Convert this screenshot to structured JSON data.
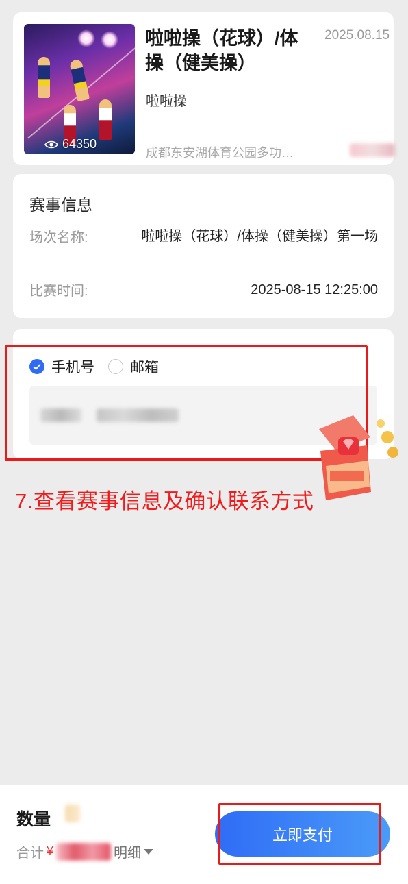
{
  "event": {
    "title": "啦啦操（花球）/体操（健美操）",
    "date": "2025.08.15",
    "category": "啦啦操",
    "venue": "成都东安湖体育公园多功…",
    "views": "64350"
  },
  "match_info": {
    "section_title": "赛事信息",
    "session_label": "场次名称:",
    "session_value": "啦啦操（花球）/体操（健美操）第一场",
    "time_label": "比赛时间:",
    "time_value": "2025-08-15 12:25:00"
  },
  "contact": {
    "options": [
      {
        "label": "手机号",
        "selected": true
      },
      {
        "label": "邮箱",
        "selected": false
      }
    ]
  },
  "annotation": "7.查看赛事信息及确认联系方式",
  "footer": {
    "quantity_label": "数量",
    "total_label": "合计",
    "currency_symbol": "¥",
    "detail_label": "明细",
    "pay_button": "立即支付"
  },
  "colors": {
    "accent": "#2f6cf6",
    "highlight": "#e91a1a",
    "annotation": "#f21a1a"
  }
}
